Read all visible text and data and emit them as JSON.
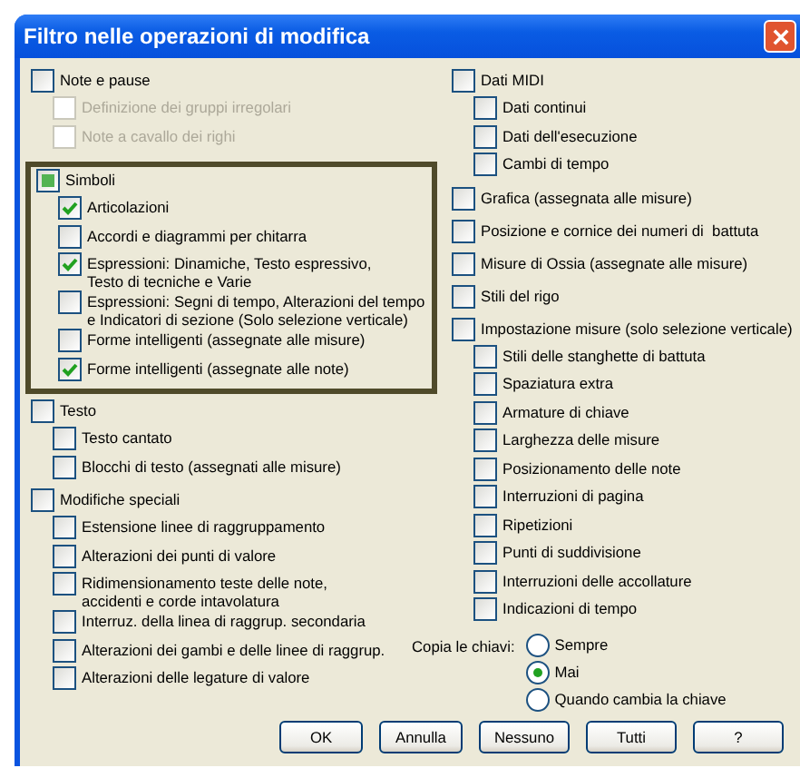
{
  "window": {
    "title": "Filtro nelle operazioni di modifica"
  },
  "left_column": [
    {
      "label": "Note e pause",
      "checked": false,
      "mixed": false,
      "highlighted": false,
      "children": [
        {
          "label": "Definizione dei gruppi irregolari",
          "checked": false,
          "disabled": true
        },
        {
          "label": "Note a cavallo dei righi",
          "checked": false,
          "disabled": true
        }
      ]
    },
    {
      "label": "Simboli",
      "checked": false,
      "mixed": true,
      "highlighted": true,
      "children": [
        {
          "label": "Articolazioni",
          "checked": true,
          "disabled": false
        },
        {
          "label": "Accordi e diagrammi per chitarra",
          "checked": false,
          "disabled": false
        },
        {
          "label": "Espressioni: Dinamiche, Testo espressivo,\nTesto di tecniche e Varie",
          "checked": true,
          "disabled": false
        },
        {
          "label": "Espressioni: Segni di tempo, Alterazioni del tempo\ne Indicatori di sezione (Solo selezione verticale)",
          "checked": false,
          "disabled": false
        },
        {
          "label": "Forme intelligenti (assegnate alle misure)",
          "checked": false,
          "disabled": false
        },
        {
          "label": "Forme intelligenti (assegnate alle note)",
          "checked": true,
          "disabled": false
        }
      ]
    },
    {
      "label": "Testo",
      "checked": false,
      "mixed": false,
      "highlighted": false,
      "children": [
        {
          "label": "Testo cantato",
          "checked": false,
          "disabled": false
        },
        {
          "label": "Blocchi di testo (assegnati alle misure)",
          "checked": false,
          "disabled": false
        }
      ]
    },
    {
      "label": "Modifiche speciali",
      "checked": false,
      "mixed": false,
      "highlighted": false,
      "children": [
        {
          "label": "Estensione linee di raggruppamento",
          "checked": false,
          "disabled": false
        },
        {
          "label": "Alterazioni dei punti di valore",
          "checked": false,
          "disabled": false
        },
        {
          "label": "Ridimensionamento teste delle note,\naccidenti e corde intavolatura",
          "checked": false,
          "disabled": false
        },
        {
          "label": "Interruz. della linea di raggrup. secondaria",
          "checked": false,
          "disabled": false
        },
        {
          "label": "Alterazioni dei gambi e delle linee di raggrup.",
          "checked": false,
          "disabled": false
        },
        {
          "label": "Alterazioni delle legature di valore",
          "checked": false,
          "disabled": false
        }
      ]
    }
  ],
  "right_column": [
    {
      "label": "Dati MIDI",
      "checked": false,
      "mixed": false,
      "highlighted": false,
      "children": [
        {
          "label": "Dati continui",
          "checked": false,
          "disabled": false
        },
        {
          "label": "Dati dell'esecuzione",
          "checked": false,
          "disabled": false
        },
        {
          "label": "Cambi di tempo",
          "checked": false,
          "disabled": false
        }
      ]
    },
    {
      "label": "Grafica (assegnata alle misure)",
      "checked": false,
      "mixed": false,
      "highlighted": false
    },
    {
      "label": "Posizione e cornice dei numeri di  battuta",
      "checked": false,
      "mixed": false,
      "highlighted": false
    },
    {
      "label": "Misure di Ossia (assegnate alle misure)",
      "checked": false,
      "mixed": false,
      "highlighted": false
    },
    {
      "label": "Stili del rigo",
      "checked": false,
      "mixed": false,
      "highlighted": false
    },
    {
      "label": "Impostazione misure (solo selezione verticale)",
      "checked": false,
      "mixed": false,
      "highlighted": false,
      "children": [
        {
          "label": "Stili delle stanghette di battuta",
          "checked": false,
          "disabled": false
        },
        {
          "label": "Spaziatura extra",
          "checked": false,
          "disabled": false
        },
        {
          "label": "Armature di chiave",
          "checked": false,
          "disabled": false
        },
        {
          "label": "Larghezza delle misure",
          "checked": false,
          "disabled": false
        },
        {
          "label": "Posizionamento delle note",
          "checked": false,
          "disabled": false
        },
        {
          "label": "Interruzioni di pagina",
          "checked": false,
          "disabled": false
        },
        {
          "label": "Ripetizioni",
          "checked": false,
          "disabled": false
        },
        {
          "label": "Punti di suddivisione",
          "checked": false,
          "disabled": false
        },
        {
          "label": "Interruzioni delle accollature",
          "checked": false,
          "disabled": false
        },
        {
          "label": "Indicazioni di tempo",
          "checked": false,
          "disabled": false
        }
      ]
    }
  ],
  "copy_clefs": {
    "label": "Copia le chiavi:",
    "options": [
      {
        "label": "Sempre",
        "selected": false
      },
      {
        "label": "Mai",
        "selected": true
      },
      {
        "label": "Quando cambia la chiave",
        "selected": false
      }
    ]
  },
  "buttons": [
    "OK",
    "Annulla",
    "Nessuno",
    "Tutti",
    "?"
  ]
}
